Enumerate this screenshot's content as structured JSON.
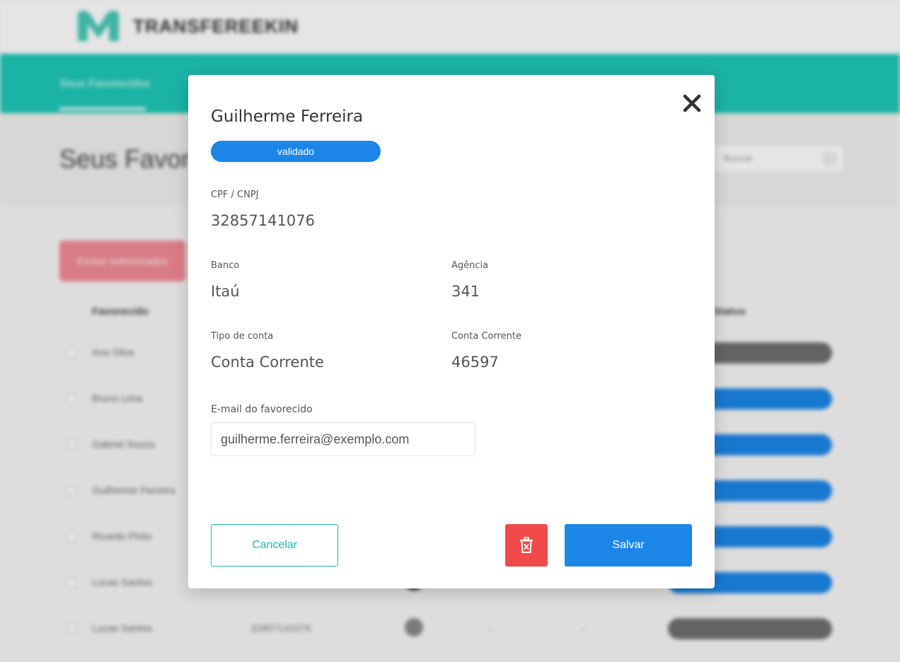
{
  "background": {
    "logo_text": "TRANSFEREEKIN",
    "nav_item": "Seus Favorecidos",
    "page_title": "Seus Favorecidos",
    "search_placeholder": "Buscar",
    "delete_selected_label": "Excluir selecionados",
    "table_headers": {
      "name": "Favorecido",
      "status": "Status"
    },
    "rows": [
      {
        "name": "Ana Silva",
        "document": "",
        "agency": "",
        "account": "",
        "status": "",
        "status_color": "gray"
      },
      {
        "name": "Bruno Lima",
        "document": "",
        "agency": "",
        "account": "",
        "status": "",
        "status_color": "blue"
      },
      {
        "name": "Gabriel Souza",
        "document": "",
        "agency": "",
        "account": "",
        "status": "",
        "status_color": "blue"
      },
      {
        "name": "Guilherme Ferreira",
        "document": "",
        "agency": "",
        "account": "",
        "status": "",
        "status_color": "blue"
      },
      {
        "name": "Ricardo Pinto",
        "document": "",
        "agency": "",
        "account": "",
        "status": "",
        "status_color": "blue"
      },
      {
        "name": "Lucas Santos",
        "document": "",
        "agency": "",
        "account": "",
        "status": "",
        "status_color": "blue"
      },
      {
        "name": "Lucas Santos",
        "document": "32857141076",
        "agency": "-",
        "account": "-",
        "status": "",
        "status_color": "gray"
      }
    ]
  },
  "modal": {
    "title": "Guilherme Ferreira",
    "status_badge": "validado",
    "cpf_label": "CPF / CNPJ",
    "cpf_value": "32857141076",
    "bank_label": "Banco",
    "bank_value": "Itaú",
    "agency_label": "Agência",
    "agency_value": "341",
    "account_type_label": "Tipo de conta",
    "account_type_value": "Conta Corrente",
    "account_label": "Conta Corrente",
    "account_value": "46597",
    "email_label": "E-mail do favorecido",
    "email_value": "guilherme.ferreira@exemplo.com",
    "cancel_label": "Cancelar",
    "save_label": "Salvar"
  },
  "colors": {
    "accent_teal": "#1ec8b8",
    "primary_blue": "#1b86e8",
    "danger_red": "#f24a4a"
  }
}
